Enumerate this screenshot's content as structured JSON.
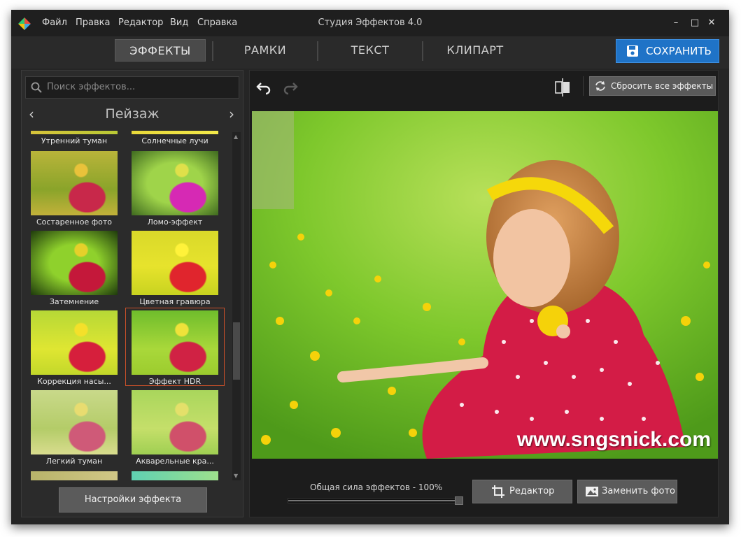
{
  "app": {
    "title": "Студия Эффектов 4.0"
  },
  "menu": [
    "Файл",
    "Правка",
    "Редактор",
    "Вид",
    "Справка"
  ],
  "window_controls": {
    "minimize": "–",
    "maximize": "□",
    "close": "✕"
  },
  "tabs": [
    {
      "label": "ЭФФЕКТЫ",
      "active": true
    },
    {
      "label": "РАМКИ",
      "active": false
    },
    {
      "label": "ТЕКСТ",
      "active": false
    },
    {
      "label": "КЛИПАРТ",
      "active": false
    }
  ],
  "save_button": {
    "label": "СОХРАНИТЬ",
    "icon": "floppy-icon",
    "color": "#1f73c7"
  },
  "search": {
    "placeholder": "Поиск эффектов..."
  },
  "category": {
    "name": "Пейзаж",
    "prev": "‹",
    "next": "›"
  },
  "effects": [
    {
      "label": "Утренний туман"
    },
    {
      "label": "Солнечные лучи"
    },
    {
      "label": "Состаренное фото"
    },
    {
      "label": "Ломо-эффект"
    },
    {
      "label": "Затемнение"
    },
    {
      "label": "Цветная гравюра"
    },
    {
      "label": "Коррекция насы..."
    },
    {
      "label": "Эффект HDR",
      "selected": true
    },
    {
      "label": "Легкий туман"
    },
    {
      "label": "Акварельные кра..."
    }
  ],
  "effect_settings": {
    "label": "Настройки эффекта"
  },
  "toolbar": {
    "undo": "undo-icon",
    "redo": "redo-icon",
    "compare": "compare-icon",
    "reset_label": "Сбросить все эффекты"
  },
  "photo": {
    "watermark": "www.sngsnick.com"
  },
  "strength": {
    "label": "Общая сила эффектов - 100%",
    "value": 1.0
  },
  "editor_button": {
    "label": "Редактор"
  },
  "replace_button": {
    "label": "Заменить фото"
  },
  "colors": {
    "accent": "#1f73c7",
    "selection": "#c9502a"
  }
}
